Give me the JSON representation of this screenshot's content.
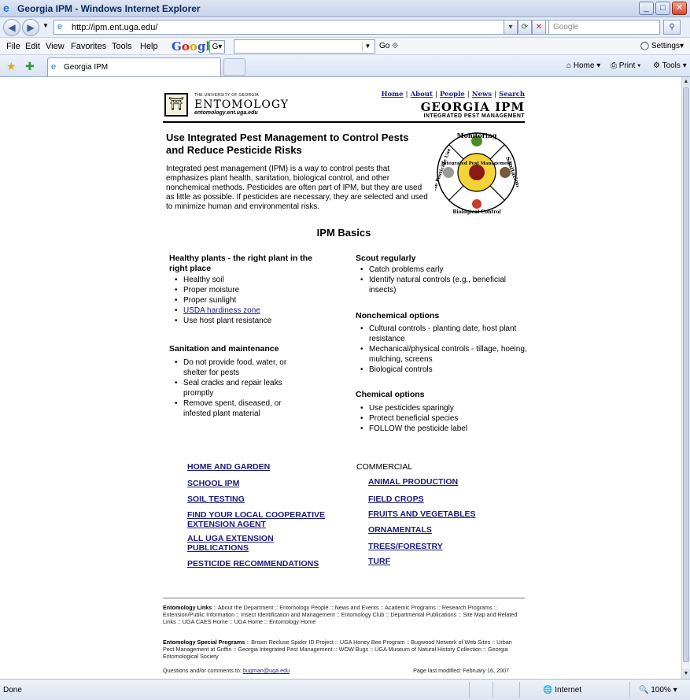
{
  "window": {
    "title": "Georgia IPM - Windows Internet Explorer"
  },
  "address": {
    "url": "http://ipm.ent.uga.edu/",
    "search_placeholder": "Google"
  },
  "menu": [
    "File",
    "Edit",
    "View",
    "Favorites",
    "Tools",
    "Help"
  ],
  "google_toolbar": {
    "logo": "Google",
    "go_label": "Go",
    "settings_label": "Settings"
  },
  "tab": {
    "label": "Georgia IPM"
  },
  "command_bar": {
    "home": "Home",
    "print": "Print",
    "tools": "Tools"
  },
  "header": {
    "uga_small": "THE UNIVERSITY OF GEORGIA",
    "dept": "ENTOMOLOGY",
    "dept_url": "entomology.ent.uga.edu",
    "nav": [
      "Home",
      "About",
      "People",
      "News",
      "Search"
    ],
    "site_title": "GEORGIA IPM",
    "site_subtitle": "INTEGRATED PEST MANAGEMENT"
  },
  "intro": {
    "title": "Use Integrated Pest Management to Control Pests and Reduce Pesticide Risks",
    "text": "Integrated pest management (IPM) is a way to control pests that emphasizes plant health, sanitation, biological control, and other nonchemical methods. Pesticides are often part of IPM, but they are used as little as possible. If pesticides are necessary, they are selected and used to minimize human and environmental risks.",
    "wheel_labels": {
      "top": "Monitoring",
      "right": "Sanitation",
      "bottom": "Biological Control",
      "left": "Wise Pesticide Use",
      "center": "Integrated Pest Management"
    }
  },
  "basics": {
    "title": "IPM Basics",
    "left": [
      {
        "heading": "Healthy plants - the right plant in the right place",
        "items": [
          "Healthy soil",
          "Proper moisture",
          "Proper sunlight",
          "USDA hardiness zone",
          "Use host plant resistance"
        ]
      },
      {
        "heading": "Sanitation and maintenance",
        "items": [
          "Do not provide food, water, or shelter for pests",
          "Seal cracks and repair leaks promptly",
          "Remove spent, diseased, or infested plant material"
        ]
      }
    ],
    "right": [
      {
        "heading": "Scout regularly",
        "items": [
          "Catch problems early",
          "Identify natural controls (e.g., beneficial insects)"
        ]
      },
      {
        "heading": "Nonchemical options",
        "items": [
          "Cultural controls - planting date, host plant resistance",
          "Mechanical/physical controls - tillage, hoeing, mulching, screens",
          "Biological controls"
        ]
      },
      {
        "heading": "Chemical options",
        "items": [
          "Use pesticides sparingly",
          "Protect beneficial species",
          "FOLLOW the pesticide label"
        ]
      }
    ]
  },
  "links_left": [
    "HOME AND GARDEN",
    "SCHOOL IPM",
    "SOIL TESTING",
    "FIND YOUR LOCAL COOPERATIVE EXTENSION AGENT",
    "ALL UGA EXTENSION PUBLICATIONS",
    "PESTICIDE RECOMMENDATIONS"
  ],
  "commercial": {
    "heading": "COMMERCIAL",
    "links": [
      "ANIMAL PRODUCTION",
      "FIELD CROPS",
      "FRUITS AND VEGETABLES",
      "ORNAMENTALS",
      "TREES/FORESTRY",
      "TURF"
    ]
  },
  "footer": {
    "ent_links_label": "Entomology Links",
    "ent_links": [
      "About the Department",
      "Entomology People",
      "News and Events",
      "Academic Programs",
      "Research Programs",
      "Extension/Public Information",
      "Insect Identification and Management",
      "Entomology Club",
      "Departmental Publications",
      "Site Map and Related Links",
      "UGA CAES Home",
      "UGA Home",
      "Entomology Home"
    ],
    "special_label": "Entomology Special Programs",
    "special": [
      "Brown Recluse Spider ID Project",
      "UGA Honey Bee Program",
      "Bugwood Network of Web Sites",
      "Urban Pest Management at Griffin",
      "Georgia Integrated Pest Management",
      "WOW Bugs",
      "UGA Museum of Natural History Collection",
      "Georgia Entomological Society"
    ],
    "contact_prefix": "Questions and/or comments to:",
    "contact_email": "bugman@uga.edu",
    "modified": "Page last modified: February 16, 2007"
  },
  "status": {
    "left": "Done",
    "zone": "Internet",
    "zoom": "100%"
  }
}
